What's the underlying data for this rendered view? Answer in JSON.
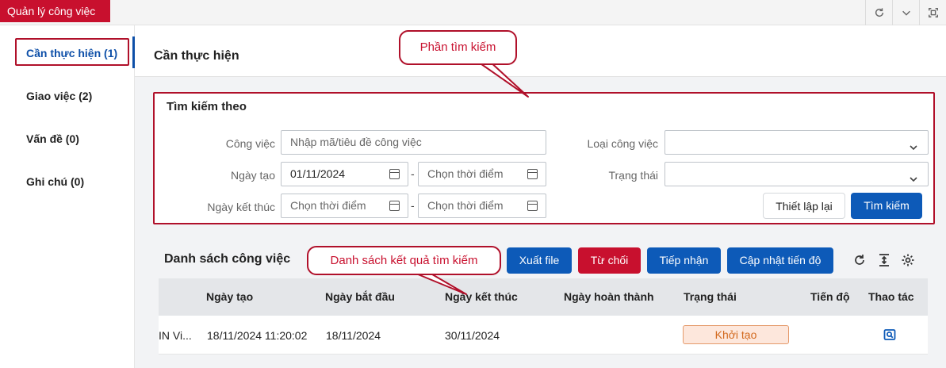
{
  "app": {
    "tab_label": "Quản lý công việc"
  },
  "topbar": {
    "icons": [
      "refresh-icon",
      "chevron-down-icon",
      "fullscreen-icon"
    ]
  },
  "sidebar": {
    "items": [
      {
        "label": "Cần thực hiện (1)",
        "active": true
      },
      {
        "label": "Giao việc (2)"
      },
      {
        "label": "Vấn đề (0)"
      },
      {
        "label": "Ghi chú (0)"
      }
    ]
  },
  "page": {
    "title": "Cần thực hiện"
  },
  "search": {
    "title": "Tìm kiếm theo",
    "cong_viec": {
      "label": "Công việc",
      "placeholder": "Nhập mã/tiêu đề công việc"
    },
    "ngay_tao": {
      "label": "Ngày tạo",
      "from_value": "01/11/2024",
      "to_placeholder": "Chọn thời điểm"
    },
    "ngay_ket_thuc": {
      "label": "Ngày kết thúc",
      "from_placeholder": "Chọn thời điểm",
      "to_placeholder": "Chọn thời điểm"
    },
    "loai_cong_viec": {
      "label": "Loại công việc",
      "value": ""
    },
    "trang_thai": {
      "label": "Trạng thái",
      "value": ""
    },
    "separator": "-",
    "reset_label": "Thiết lập lại",
    "search_label": "Tìm kiếm"
  },
  "list": {
    "title": "Danh sách công việc",
    "buttons": {
      "export": "Xuất file",
      "reject": "Từ chối",
      "accept": "Tiếp nhận",
      "update_progress": "Cập nhật tiến độ"
    },
    "columns": [
      "Ngày tạo",
      "Ngày bắt đầu",
      "Ngày kết thúc",
      "Ngày hoàn thành",
      "Trạng thái",
      "Tiến độ",
      "Thao tác"
    ],
    "rows": [
      {
        "name": "IN Vi...",
        "ngay_tao": "18/11/2024 11:20:02",
        "ngay_bat_dau": "18/11/2024",
        "ngay_ket_thuc": "30/11/2024",
        "ngay_hoan_thanh": "",
        "trang_thai": "Khởi tạo",
        "tien_do": ""
      }
    ]
  },
  "callouts": {
    "search_section": "Phần tìm kiếm",
    "result_list": "Danh sách kết quả tìm kiếm"
  },
  "colors": {
    "brand_red": "#c8102e",
    "primary_blue": "#0d5ab8",
    "active_text": "#0d4fa8",
    "status_orange": "#d2691e"
  }
}
